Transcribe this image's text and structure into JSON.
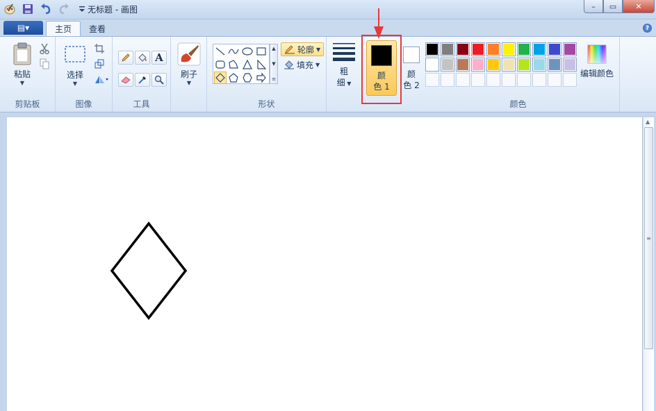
{
  "titlebar": {
    "title": "无标题 - 画图",
    "minimize": "–",
    "maximize": "▭",
    "close": "✕"
  },
  "tabs": {
    "file_icon": "▤▾",
    "home": "主页",
    "view": "查看"
  },
  "help": "?",
  "clipboard": {
    "paste": "粘贴",
    "group_label": "剪贴板"
  },
  "image": {
    "select": "选择",
    "group_label": "图像"
  },
  "tools": {
    "text_tool": "A",
    "group_label": "工具"
  },
  "brushes": {
    "label": "刷子"
  },
  "shapes": {
    "outline": "轮廓",
    "fill": "填充",
    "group_label": "形状"
  },
  "size": {
    "line1": "粗",
    "line2": "细"
  },
  "colors": {
    "color1_line1": "颜",
    "color1_line2": "色 1",
    "color2_line1": "颜",
    "color2_line2": "色 2",
    "edit_colors": "编辑颜色",
    "group_label": "颜色",
    "color1_value": "#000000",
    "color2_value": "#ffffff",
    "palette_row1": [
      "#000000",
      "#7f7f7f",
      "#880015",
      "#ed1c24",
      "#ff7f27",
      "#fff200",
      "#22b14c",
      "#00a2e8",
      "#3f48cc",
      "#a349a4"
    ],
    "palette_row2": [
      "#ffffff",
      "#c3c3c3",
      "#b97a57",
      "#ffaec9",
      "#ffc90e",
      "#efe4b0",
      "#b5e61d",
      "#99d9ea",
      "#7092be",
      "#c8bfe7"
    ]
  },
  "canvas_shape": {
    "type": "diamond",
    "stroke": "#000000"
  }
}
